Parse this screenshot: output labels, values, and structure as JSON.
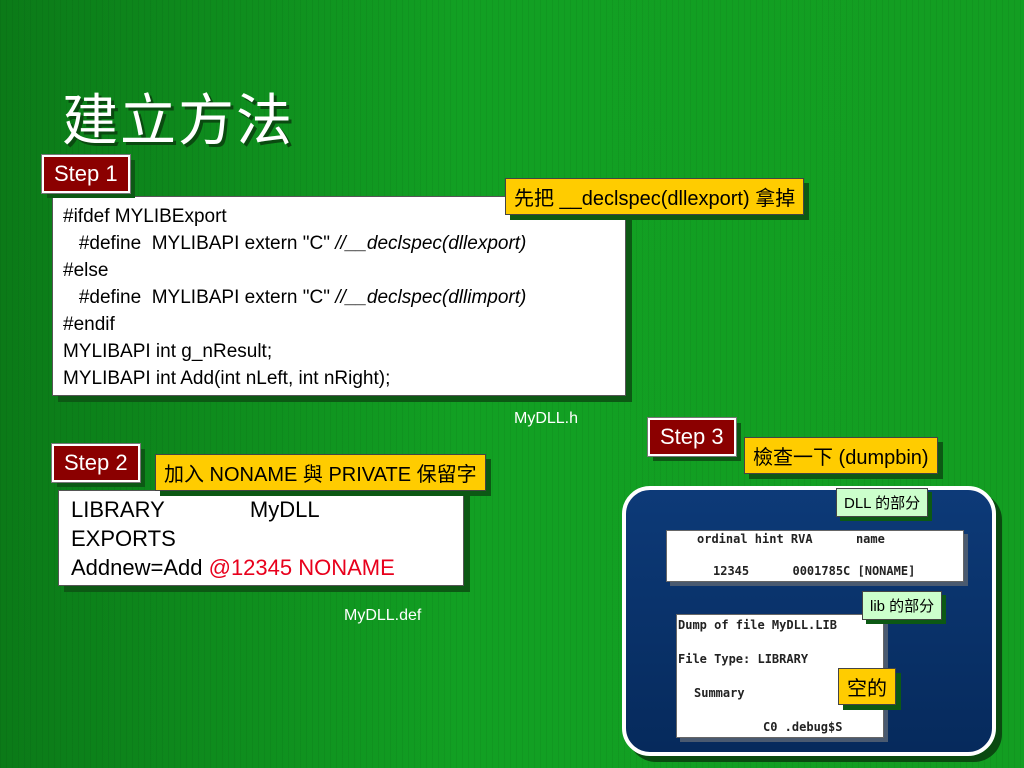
{
  "title": "建立方法",
  "step1": {
    "label": "Step 1",
    "note": "先把 __declspec(dllexport) 拿掉",
    "code": {
      "l1": "#ifdef MYLIBExport",
      "l2a": "   #define  MYLIBAPI extern \"C\" ",
      "l2b": "//__declspec(dllexport)",
      "l3": "#else",
      "l4a": "   #define  MYLIBAPI extern \"C\" ",
      "l4b": "//__declspec(dllimport)",
      "l5": "#endif",
      "l6": "MYLIBAPI int g_nResult;",
      "l7": "MYLIBAPI int Add(int nLeft, int nRight);"
    },
    "caption": "MyDLL.h"
  },
  "step2": {
    "label": "Step 2",
    "note": "加入 NONAME 與 PRIVATE 保留字",
    "code": {
      "l1": "LIBRARY              MyDLL",
      "l2": "EXPORTS",
      "l3a": "Addnew=Add ",
      "l3b": "@12345 NONAME"
    },
    "caption": "MyDLL.def"
  },
  "step3": {
    "label": "Step 3",
    "note": "檢查一下 (dumpbin)",
    "dll_note": "DLL 的部分",
    "lib_note": "lib 的部分",
    "empty_note": "空的",
    "dump_dll": {
      "header": "ordinal hint RVA      name",
      "row": "12345      0001785C [NONAME]"
    },
    "dump_lib": {
      "l1": "Dump of file MyDLL.LIB",
      "l2": "File Type: LIBRARY",
      "l3": "Summary",
      "l4": "C0 .debug$S"
    }
  }
}
